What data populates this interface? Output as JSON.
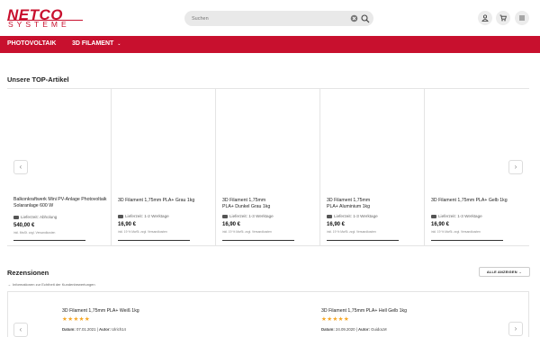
{
  "brand": {
    "line1": "NETCO",
    "line2": "SYSTEME",
    "color": "#c8102e"
  },
  "search": {
    "placeholder": "Suchen"
  },
  "header_icons": [
    "account-icon",
    "cart-icon",
    "menu-icon"
  ],
  "nav": {
    "items": [
      "PHOTOVOLTAIK",
      "3D FILAMENT"
    ]
  },
  "top_section": {
    "title": "Unsere TOP-Artikel"
  },
  "products": [
    {
      "name": "Balkonkraftwerk Mini PV-Anlage Photovoltaik Solaranlage 600 W",
      "delivery": "Lieferzeit: Abholung",
      "price": "540,00 €",
      "tax": "inkl. MwSt. zzgl. Versandkosten"
    },
    {
      "name": "3D Filament 1,75mm PLA+ Grau 1kg",
      "delivery": "Lieferzeit: 1-2 Werktage",
      "price": "16,90 €",
      "tax": "inkl. 19 % MwSt. zzgl. Versandkosten"
    },
    {
      "name": "3D Filament 1,75mm PLA+ Dunkel Grau 1kg",
      "delivery": "Lieferzeit: 1-3 Werktage",
      "price": "16,90 €",
      "tax": "inkl. 19 % MwSt. zzgl. Versandkosten"
    },
    {
      "name": "3D Filament 1,75mm PLA+ Aluminium 1kg",
      "delivery": "Lieferzeit: 1-3 Werktage",
      "price": "16,90 €",
      "tax": "inkl. 19 % MwSt. zzgl. Versandkosten"
    },
    {
      "name": "3D Filament 1,75mm PLA+ Gelb 1kg",
      "delivery": "Lieferzeit: 1-3 Werktage",
      "price": "16,90 €",
      "tax": "inkl. 19 % MwSt. zzgl. Versandkosten"
    }
  ],
  "reviews_section": {
    "title": "Rezensionen",
    "all_button": "ALLE ANZEIGEN →",
    "info": "Informationen zur Echtheit der Kundenbewertungen"
  },
  "reviews": [
    {
      "title": "3D Filament 1,75mm PLA+ Weiß 1kg",
      "stars": "★★★★★",
      "rating": 5,
      "date_label": "Datum:",
      "date": "07.01.2021",
      "author_label": "Autor:",
      "author": "Ulrich14"
    },
    {
      "title": "3D Filament 1,75mm PLA+ Hell Gelb 1kg",
      "stars": "★★★★★",
      "rating": 5,
      "date_label": "Datum:",
      "date": "24.09.2020",
      "author_label": "Autor:",
      "author": "GuidoLM"
    }
  ],
  "colors": {
    "accent": "#c8102e",
    "star": "#f5a623"
  }
}
